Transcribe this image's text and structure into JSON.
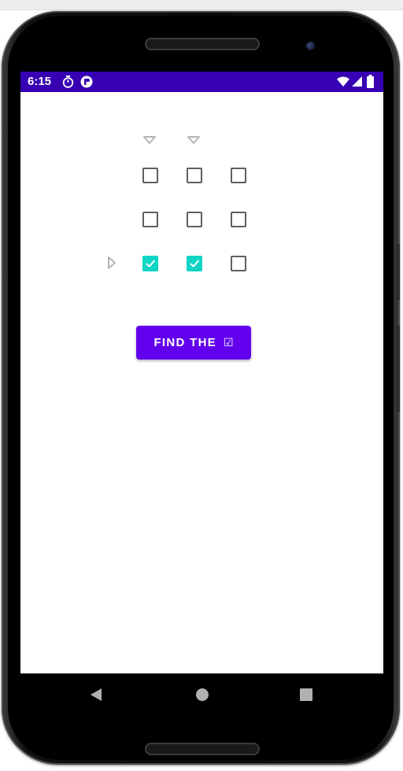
{
  "status_bar": {
    "time": "6:15",
    "left_icons": [
      "timer-icon",
      "app-notification-icon"
    ],
    "right_icons": [
      "wifi-icon",
      "cell-signal-icon",
      "battery-icon"
    ],
    "background_color": "#3700b3"
  },
  "grid": {
    "column_hint_icons": [
      "triangle-down-icon",
      "triangle-down-icon"
    ],
    "row_hint_icons": [
      "triangle-right-icon"
    ],
    "rows": [
      [
        false,
        false,
        false
      ],
      [
        false,
        false,
        false
      ],
      [
        true,
        true,
        false
      ]
    ],
    "checked_color": "#10d5c4"
  },
  "action_button": {
    "label": "FIND THE",
    "glyph": "☑",
    "color": "#6200ee"
  },
  "nav_bar": {
    "items": [
      "back-icon",
      "home-icon",
      "recents-icon"
    ]
  }
}
